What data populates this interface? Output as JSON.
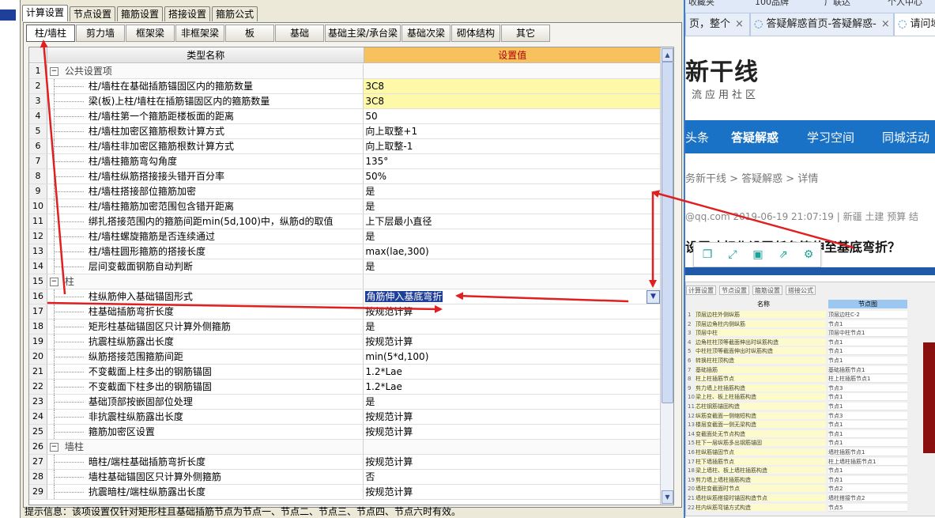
{
  "left_strip": {
    "label": "B"
  },
  "top_tabs": [
    "计算设置",
    "节点设置",
    "箍筋设置",
    "搭接设置",
    "箍筋公式"
  ],
  "sub_tabs": [
    "柱/墙柱",
    "剪力墙",
    "框架梁",
    "非框架梁",
    "板",
    "基础",
    "基础主梁/承台梁",
    "基础次梁",
    "砌体结构",
    "其它"
  ],
  "grid": {
    "col_name": "类型名称",
    "col_value": "设置值",
    "rows": [
      {
        "num": "1",
        "name": "公共设置项",
        "value": "",
        "group": true
      },
      {
        "num": "2",
        "name": "柱/墙柱在基础插筋锚固区内的箍筋数量",
        "value": "3C8",
        "yellow": true
      },
      {
        "num": "3",
        "name": "梁(板)上柱/墙柱在插筋锚固区内的箍筋数量",
        "value": "3C8",
        "yellow": true
      },
      {
        "num": "4",
        "name": "柱/墙柱第一个箍筋距楼板面的距离",
        "value": "50"
      },
      {
        "num": "5",
        "name": "柱/墙柱加密区箍筋根数计算方式",
        "value": "向上取整+1"
      },
      {
        "num": "6",
        "name": "柱/墙柱非加密区箍筋根数计算方式",
        "value": "向上取整-1"
      },
      {
        "num": "7",
        "name": "柱/墙柱箍筋弯勾角度",
        "value": "135°"
      },
      {
        "num": "8",
        "name": "柱/墙柱纵筋搭接接头错开百分率",
        "value": "50%"
      },
      {
        "num": "9",
        "name": "柱/墙柱搭接部位箍筋加密",
        "value": "是"
      },
      {
        "num": "10",
        "name": "柱/墙柱箍筋加密范围包含错开距离",
        "value": "是"
      },
      {
        "num": "11",
        "name": "绑扎搭接范围内的箍筋间距min(5d,100)中，纵筋d的取值",
        "value": "上下层最小直径"
      },
      {
        "num": "12",
        "name": "柱/墙柱螺旋箍筋是否连续通过",
        "value": "是"
      },
      {
        "num": "13",
        "name": "柱/墙柱圆形箍筋的搭接长度",
        "value": "max(lae,300)"
      },
      {
        "num": "14",
        "name": "层间变截面钢筋自动判断",
        "value": "是"
      },
      {
        "num": "15",
        "name": "柱",
        "value": "",
        "group": true
      },
      {
        "num": "16",
        "name": "柱纵筋伸入基础锚固形式",
        "value": "角筋伸入基底弯折",
        "selected": true
      },
      {
        "num": "17",
        "name": "柱基础插筋弯折长度",
        "value": "按规范计算"
      },
      {
        "num": "18",
        "name": "矩形柱基础锚固区只计算外侧箍筋",
        "value": "是"
      },
      {
        "num": "19",
        "name": "抗震柱纵筋露出长度",
        "value": "按规范计算"
      },
      {
        "num": "20",
        "name": "纵筋搭接范围箍筋间距",
        "value": "min(5*d,100)"
      },
      {
        "num": "21",
        "name": "不变截面上柱多出的钢筋锚固",
        "value": "1.2*Lae"
      },
      {
        "num": "22",
        "name": "不变截面下柱多出的钢筋锚固",
        "value": "1.2*Lae"
      },
      {
        "num": "23",
        "name": "基础顶部按嵌固部位处理",
        "value": "是"
      },
      {
        "num": "24",
        "name": "非抗震柱纵筋露出长度",
        "value": "按规范计算"
      },
      {
        "num": "25",
        "name": "箍筋加密区设置",
        "value": "按规范计算"
      },
      {
        "num": "26",
        "name": "墙柱",
        "value": "",
        "group": true
      },
      {
        "num": "27",
        "name": "暗柱/端柱基础插筋弯折长度",
        "value": "按规范计算"
      },
      {
        "num": "28",
        "name": "墙柱基础锚固区只计算外侧箍筋",
        "value": "否"
      },
      {
        "num": "29",
        "name": "抗震暗柱/端柱纵筋露出长度",
        "value": "按规范计算"
      }
    ]
  },
  "status_bar": "提示信息：该项设置仅针对矩形柱且基础插筋节点为节点一、节点二、节点三、节点四、节点六时有效。",
  "browser": {
    "bookmarks": [
      "收藏夹",
      "100品牌",
      "广联达",
      "个人中心"
    ],
    "tabs": [
      {
        "label": "页，整个",
        "close": "×"
      },
      {
        "label": "答疑解惑首页-答疑解惑-",
        "close": "×"
      },
      {
        "label": "请问域",
        "close": ""
      }
    ],
    "logo": "新干线",
    "slogan": "流应用社区",
    "nav": [
      "头条",
      "答疑解惑",
      "学习空间",
      "同城活动"
    ],
    "breadcrumb": "务新干线 > 答疑解惑 > 详情",
    "meta": "@qq.com    2019-06-19 21:07:19    |    新疆 土建 预算 结",
    "question_title": "设置才标作设置任冬箍伸至基底弯折？",
    "toolbar_icons": [
      "copy-icon",
      "expand-icon",
      "save-icon",
      "share-icon",
      "settings-icon"
    ],
    "thumbnail": {
      "tabs": [
        "计算设置",
        "节点设置",
        "箍筋设置",
        "搭接公式"
      ],
      "col_name": "名称",
      "col_value": "节点图",
      "rows": [
        {
          "i": "1",
          "a": "顶层边柱外侧纵筋",
          "b": "顶层边柱C-2"
        },
        {
          "i": "2",
          "a": "顶层边角柱内侧纵筋",
          "b": "节点1"
        },
        {
          "i": "3",
          "a": "顶层中柱",
          "b": "顶层中柱节点1"
        },
        {
          "i": "4",
          "a": "边角柱柱顶等截面伸出时纵筋构造",
          "b": "节点1"
        },
        {
          "i": "5",
          "a": "中柱柱顶等截面伸出时纵筋构造",
          "b": "节点1"
        },
        {
          "i": "6",
          "a": "转换柱柱顶构造",
          "b": "节点1"
        },
        {
          "i": "7",
          "a": "基础插筋",
          "b": "基础插筋节点1"
        },
        {
          "i": "8",
          "a": "柱上柱插筋节点",
          "b": "柱上柱插筋节点1"
        },
        {
          "i": "9",
          "a": "剪力墙上柱插筋构造",
          "b": "节点3"
        },
        {
          "i": "10",
          "a": "梁上柱、板上柱插筋构造",
          "b": "节点1"
        },
        {
          "i": "11",
          "a": "芯柱钢筋锚固构造",
          "b": "节点1"
        },
        {
          "i": "12",
          "a": "纵筋变截面一侧缩短构造",
          "b": "节点3"
        },
        {
          "i": "13",
          "a": "楼层变截面一侧无梁构造",
          "b": "节点1"
        },
        {
          "i": "14",
          "a": "变截面处无节点构造",
          "b": "节点1"
        },
        {
          "i": "15",
          "a": "柱下一层纵筋多出钢筋锚固",
          "b": "节点1"
        },
        {
          "i": "16",
          "a": "柱纵筋锚固节点",
          "b": "墙柱插筋节点1"
        },
        {
          "i": "17",
          "a": "柱下墙插筋节点",
          "b": "柱上墙柱插筋节点1"
        },
        {
          "i": "18",
          "a": "梁上墙柱、板上墙柱插筋构造",
          "b": "节点1"
        },
        {
          "i": "19",
          "a": "剪力墙上墙柱插筋构造",
          "b": "节点1"
        },
        {
          "i": "20",
          "a": "墙柱变截面时节点",
          "b": "节点2"
        },
        {
          "i": "21",
          "a": "墙柱纵筋搭接时锚固构造节点",
          "b": "墙柱搭接节点2"
        },
        {
          "i": "22",
          "a": "柱内纵筋弯锚方式构造",
          "b": "节点5"
        }
      ]
    }
  },
  "colors": {
    "accent": "#1a72c7",
    "selection": "#1e3f9a",
    "value_header": "#f7c25d",
    "annotation": "#e02020"
  }
}
